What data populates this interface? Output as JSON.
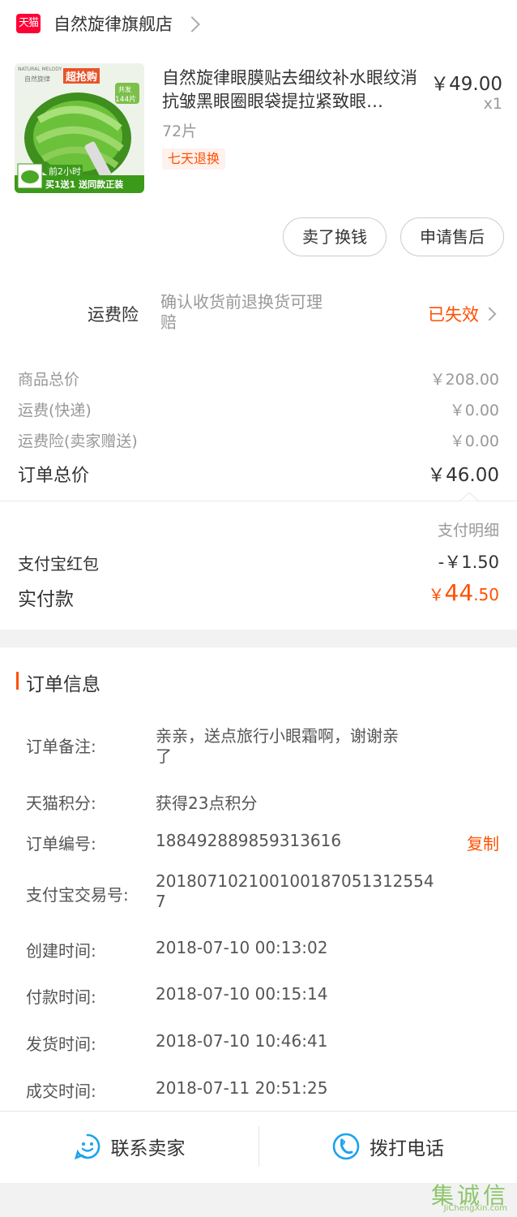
{
  "store": {
    "badge": "天猫",
    "name": "自然旋律旗舰店"
  },
  "product": {
    "title": "自然旋律眼膜贴去细纹补水眼纹消抗皱黑眼圈眼袋提拉紧致眼…",
    "spec": "72片",
    "tag": "七天退换",
    "price": "￥49.00",
    "qty": "x1",
    "thumb": {
      "brand": "NATURAL MELODY",
      "brand_cn": "自然旋律",
      "promo": "超抢购",
      "badge_top": "共发",
      "badge_bottom": "144片",
      "time": "前2小时",
      "offer": "买1送1 送同款正装"
    }
  },
  "actions": {
    "sell_label": "卖了换钱",
    "aftersale_label": "申请售后"
  },
  "insurance": {
    "label": "运费险",
    "desc": "确认收货前退换货可理赔",
    "status": "已失效"
  },
  "costs": [
    {
      "label": "商品总价",
      "value": "￥208.00"
    },
    {
      "label": "运费(快递)",
      "value": "￥0.00"
    },
    {
      "label": "运费险(卖家赠送)",
      "value": "￥0.00"
    }
  ],
  "order_total": {
    "label": "订单总价",
    "value": "￥46.00"
  },
  "payment": {
    "detail_label": "支付明细",
    "redpacket_label": "支付宝红包",
    "redpacket_value": "-￥1.50",
    "paid_label": "实付款",
    "paid_currency": "￥",
    "paid_int": "44",
    "paid_dec": ".50"
  },
  "order_info": {
    "title": "订单信息",
    "note_label": "订单备注:",
    "note_value_line1": "亲亲，送点旅行小眼霜啊，谢谢亲",
    "note_value_line2": "了",
    "points_label": "天猫积分:",
    "points_value": "获得23点积分",
    "order_no_label": "订单编号:",
    "order_no_value": "1884928898593136​16",
    "copy_label": "复制",
    "alipay_label": "支付宝交易号:",
    "alipay_value_line1": "201807102100100187051312554",
    "alipay_value_line2": "7",
    "created_label": "创建时间:",
    "created_value": "2018-07-10 00:13:02",
    "paid_time_label": "付款时间:",
    "paid_time_value": "2018-07-10 00:15:14",
    "shipped_label": "发货时间:",
    "shipped_value": "2018-07-10 10:46:41",
    "closed_label": "成交时间:",
    "closed_value": "2018-07-11 20:51:25"
  },
  "bottom": {
    "contact_label": "联系卖家",
    "call_label": "拨打电话"
  },
  "watermark": {
    "cn": "集诚信",
    "en": "JiChengXin.com"
  },
  "colors": {
    "accent": "#ff5000",
    "tmall": "#ff0036",
    "icon_blue": "#1aa3ef"
  }
}
